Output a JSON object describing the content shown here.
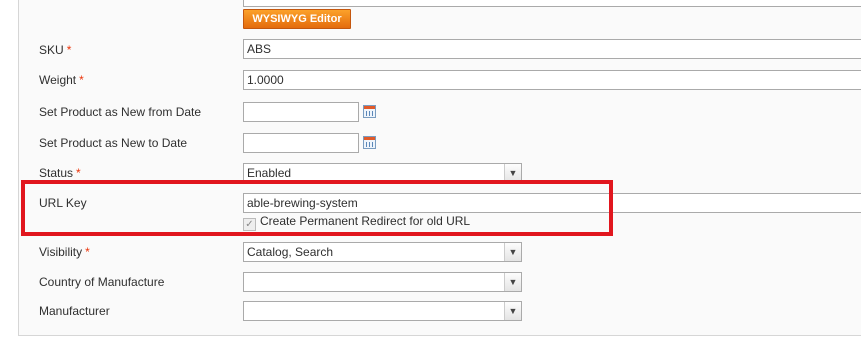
{
  "toolbar": {
    "wysiwyg_label": "WYSIWYG Editor"
  },
  "fields": {
    "sku": {
      "label": "SKU",
      "value": "ABS"
    },
    "weight": {
      "label": "Weight",
      "value": "1.0000"
    },
    "new_from": {
      "label": "Set Product as New from Date",
      "value": ""
    },
    "new_to": {
      "label": "Set Product as New to Date",
      "value": ""
    },
    "status": {
      "label": "Status",
      "value": "Enabled"
    },
    "url_key": {
      "label": "URL Key",
      "value": "able-brewing-system",
      "redirect_label": "Create Permanent Redirect for old URL",
      "redirect_checked": true
    },
    "visibility": {
      "label": "Visibility",
      "value": "Catalog, Search"
    },
    "country": {
      "label": "Country of Manufacture",
      "value": ""
    },
    "manufacturer": {
      "label": "Manufacturer",
      "value": ""
    }
  },
  "required_mark": "*",
  "highlight_color": "#e1161e",
  "button_color": "#f18200"
}
